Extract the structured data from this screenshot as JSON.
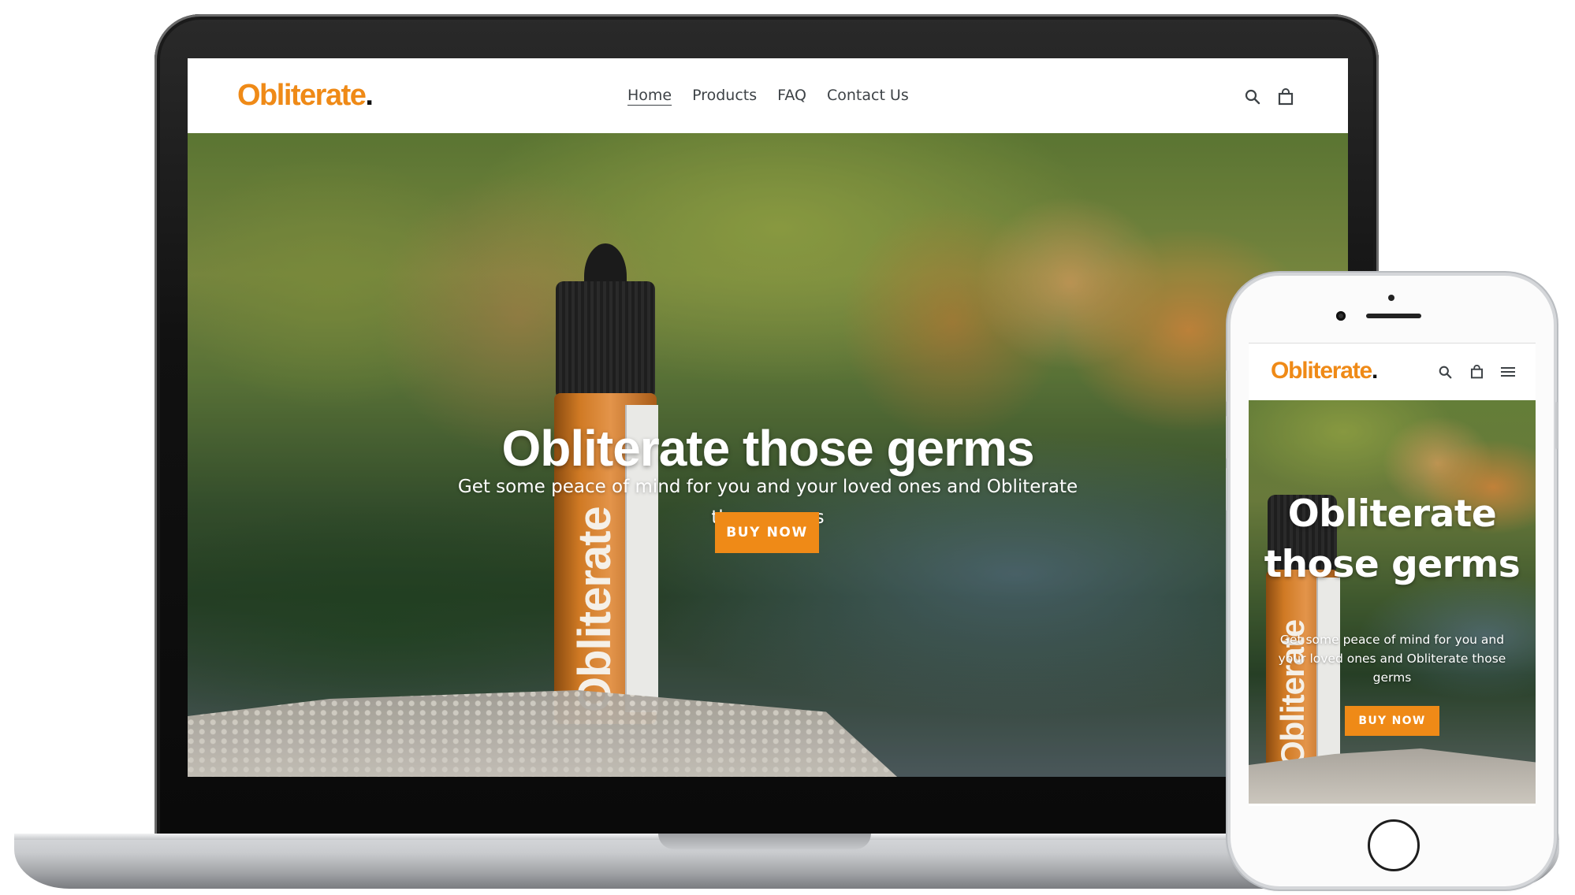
{
  "brand": {
    "name": "Obliterate",
    "dot": ".",
    "accent_color": "#ef8a17"
  },
  "desktop": {
    "nav": [
      {
        "label": "Home",
        "active": true
      },
      {
        "label": "Products",
        "active": false
      },
      {
        "label": "FAQ",
        "active": false
      },
      {
        "label": "Contact Us",
        "active": false
      }
    ],
    "icons": [
      "search-icon",
      "cart-icon"
    ],
    "hero": {
      "title": "Obliterate those germs",
      "subtitle": "Get some peace of mind for you and your loved ones and Obliterate those germs",
      "cta_label": "BUY NOW"
    }
  },
  "mobile": {
    "icons": [
      "search-icon",
      "cart-icon",
      "menu-icon"
    ],
    "hero": {
      "title": "Obliterate those germs",
      "subtitle": "Get some peace of mind for you and your loved ones and Obliterate those germs",
      "cta_label": "BUY NOW"
    }
  },
  "product_label": {
    "brand_text": "Obliterate"
  }
}
